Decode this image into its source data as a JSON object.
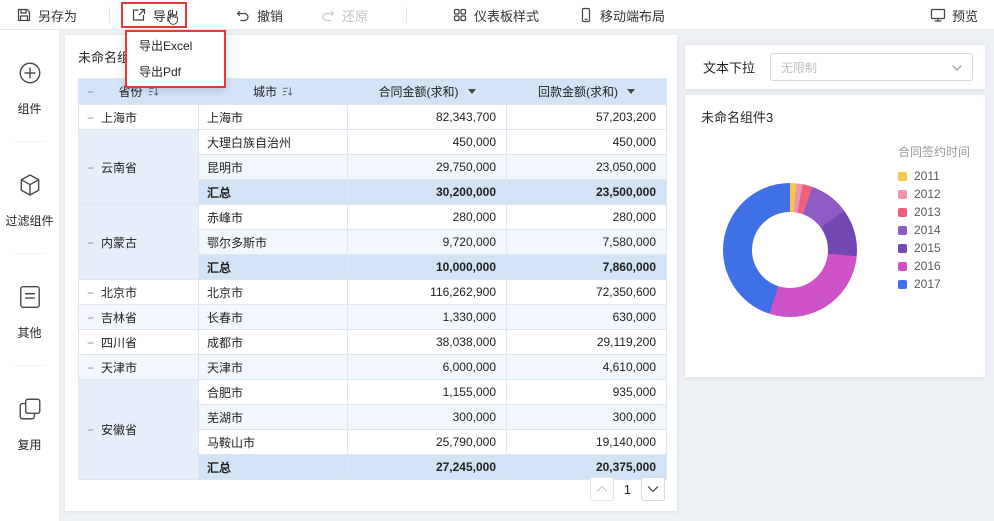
{
  "toolbar": {
    "save_as": "另存为",
    "export": "导出",
    "undo": "撤销",
    "redo": "还原",
    "dashboard_style": "仪表板样式",
    "mobile_layout": "移动端布局",
    "preview": "预览"
  },
  "export_menu": {
    "items": [
      "导出Excel",
      "导出Pdf"
    ]
  },
  "sidebar": {
    "items": [
      {
        "label": "组件"
      },
      {
        "label": "过滤组件"
      },
      {
        "label": "其他"
      },
      {
        "label": "复用"
      }
    ]
  },
  "table_panel": {
    "title": "未命名组件",
    "columns": {
      "province": "省份",
      "city": "城市",
      "contract": "合同金额(求和)",
      "payment": "回款金额(求和)"
    },
    "summary_label": "汇总",
    "groups": [
      {
        "province": "上海市",
        "rows": [
          {
            "city": "上海市",
            "contract": "82,343,700",
            "payment": "57,203,200",
            "variant": "normal"
          }
        ]
      },
      {
        "province": "云南省",
        "rows": [
          {
            "city": "大理白族自治州",
            "contract": "450,000",
            "payment": "450,000",
            "variant": "normal"
          },
          {
            "city": "昆明市",
            "contract": "29,750,000",
            "payment": "23,050,000",
            "variant": "alt"
          },
          {
            "city": "汇总",
            "contract": "30,200,000",
            "payment": "23,500,000",
            "variant": "total"
          }
        ]
      },
      {
        "province": "内蒙古",
        "rows": [
          {
            "city": "赤峰市",
            "contract": "280,000",
            "payment": "280,000",
            "variant": "normal"
          },
          {
            "city": "鄂尔多斯市",
            "contract": "9,720,000",
            "payment": "7,580,000",
            "variant": "alt"
          },
          {
            "city": "汇总",
            "contract": "10,000,000",
            "payment": "7,860,000",
            "variant": "total"
          }
        ]
      },
      {
        "province": "北京市",
        "rows": [
          {
            "city": "北京市",
            "contract": "116,262,900",
            "payment": "72,350,600",
            "variant": "normal"
          }
        ]
      },
      {
        "province": "吉林省",
        "rows": [
          {
            "city": "长春市",
            "contract": "1,330,000",
            "payment": "630,000",
            "variant": "alt"
          }
        ]
      },
      {
        "province": "四川省",
        "rows": [
          {
            "city": "成都市",
            "contract": "38,038,000",
            "payment": "29,119,200",
            "variant": "normal"
          }
        ]
      },
      {
        "province": "天津市",
        "rows": [
          {
            "city": "天津市",
            "contract": "6,000,000",
            "payment": "4,610,000",
            "variant": "alt"
          }
        ]
      },
      {
        "province": "安徽省",
        "rows": [
          {
            "city": "合肥市",
            "contract": "1,155,000",
            "payment": "935,000",
            "variant": "normal"
          },
          {
            "city": "芜湖市",
            "contract": "300,000",
            "payment": "300,000",
            "variant": "alt"
          },
          {
            "city": "马鞍山市",
            "contract": "25,790,000",
            "payment": "19,140,000",
            "variant": "normal"
          },
          {
            "city": "汇总",
            "contract": "27,245,000",
            "payment": "20,375,000",
            "variant": "total"
          }
        ]
      }
    ],
    "pagination": {
      "page": "1"
    }
  },
  "filter_panel": {
    "label": "文本下拉",
    "value": "无限制"
  },
  "chart_panel": {
    "title": "未命名组件3"
  },
  "chart_data": {
    "type": "pie",
    "subtype": "donut",
    "title": "合同签约时间",
    "legend_position": "right",
    "note": "slice sizes are visual estimates in percent, drawn clockwise from top",
    "series": [
      {
        "label": "2011",
        "color": "#F7C64B",
        "value_pct": 1.5
      },
      {
        "label": "2012",
        "color": "#F295A7",
        "value_pct": 1.5
      },
      {
        "label": "2013",
        "color": "#EA6280",
        "value_pct": 2.5
      },
      {
        "label": "2014",
        "color": "#8F5AC4",
        "value_pct": 9.5
      },
      {
        "label": "2015",
        "color": "#7348B2",
        "value_pct": 11.5
      },
      {
        "label": "2016",
        "color": "#CE52C8",
        "value_pct": 28.5
      },
      {
        "label": "2017",
        "color": "#4070E6",
        "value_pct": 45
      }
    ]
  }
}
